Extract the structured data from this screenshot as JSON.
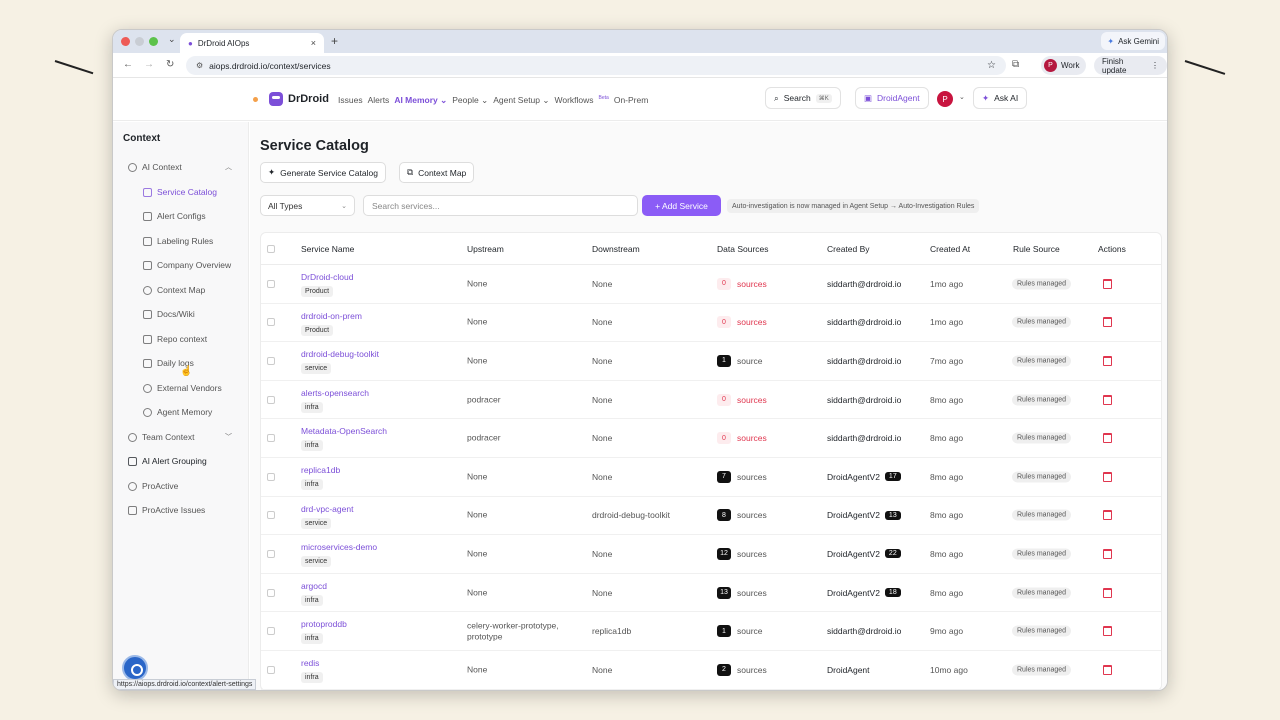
{
  "browser": {
    "tab_title": "DrDroid AIOps",
    "new_tab": "+",
    "ask_gemini": "Ask Gemini",
    "url": "aiops.drdroid.io/context/services",
    "profile_label": "Work",
    "profile_initial": "P",
    "finish_update": "Finish update",
    "status_url": "https://aiops.drdroid.io/context/alert-settings"
  },
  "header": {
    "brand": "DrDroid",
    "nav": [
      {
        "label": "Issues"
      },
      {
        "label": "Alerts"
      },
      {
        "label": "AI Memory ⌄"
      },
      {
        "label": "People ⌄"
      },
      {
        "label": "Agent Setup ⌄"
      },
      {
        "label": "Workflows"
      },
      {
        "label": "On-Prem"
      }
    ],
    "beta": "Beta",
    "search_label": "Search",
    "search_kbd": "⌘K",
    "droidagent_label": "DroidAgent",
    "avatar_initial": "P",
    "ask_ai_label": "Ask AI"
  },
  "sidebar": {
    "title": "Context",
    "items": [
      {
        "label": "AI Context"
      },
      {
        "label": "Service Catalog"
      },
      {
        "label": "Alert Configs"
      },
      {
        "label": "Labeling Rules"
      },
      {
        "label": "Company Overview"
      },
      {
        "label": "Context Map"
      },
      {
        "label": "Docs/Wiki"
      },
      {
        "label": "Repo context"
      },
      {
        "label": "Daily logs"
      },
      {
        "label": "External Vendors"
      },
      {
        "label": "Agent Memory"
      },
      {
        "label": "Team Context"
      },
      {
        "label": "AI Alert Grouping"
      },
      {
        "label": "ProActive"
      },
      {
        "label": "ProActive Issues"
      }
    ]
  },
  "main": {
    "title": "Service Catalog",
    "generate_label": "Generate Service Catalog",
    "context_map_label": "Context Map",
    "type_filter": "All Types",
    "search_placeholder": "Search services...",
    "add_service_label": "+ Add Service",
    "notice": "Auto-investigation is now managed in Agent Setup → Auto-Investigation Rules",
    "columns": [
      "Service Name",
      "Upstream",
      "Downstream",
      "Data Sources",
      "Created By",
      "Created At",
      "Rule Source",
      "Actions"
    ],
    "rows": [
      {
        "name": "DrDroid-cloud",
        "tag": "Product",
        "upstream": "None",
        "downstream": "None",
        "ds_count": "0",
        "ds_label": "sources",
        "created_by": "siddarth@drdroid.io",
        "created_count": "",
        "created_at": "1mo ago",
        "rule_source": "Rules managed"
      },
      {
        "name": "drdroid-on-prem",
        "tag": "Product",
        "upstream": "None",
        "downstream": "None",
        "ds_count": "0",
        "ds_label": "sources",
        "created_by": "siddarth@drdroid.io",
        "created_count": "",
        "created_at": "1mo ago",
        "rule_source": "Rules managed"
      },
      {
        "name": "drdroid-debug-toolkit",
        "tag": "service",
        "upstream": "None",
        "downstream": "None",
        "ds_count": "1",
        "ds_label": "source",
        "created_by": "siddarth@drdroid.io",
        "created_count": "",
        "created_at": "7mo ago",
        "rule_source": "Rules managed"
      },
      {
        "name": "alerts-opensearch",
        "tag": "infra",
        "upstream": "podracer",
        "downstream": "None",
        "ds_count": "0",
        "ds_label": "sources",
        "created_by": "siddarth@drdroid.io",
        "created_count": "",
        "created_at": "8mo ago",
        "rule_source": "Rules managed"
      },
      {
        "name": "Metadata-OpenSearch",
        "tag": "infra",
        "upstream": "podracer",
        "downstream": "None",
        "ds_count": "0",
        "ds_label": "sources",
        "created_by": "siddarth@drdroid.io",
        "created_count": "",
        "created_at": "8mo ago",
        "rule_source": "Rules managed"
      },
      {
        "name": "replica1db",
        "tag": "infra",
        "upstream": "None",
        "downstream": "None",
        "ds_count": "7",
        "ds_label": "sources",
        "created_by": "DroidAgentV2",
        "created_count": "17",
        "created_at": "8mo ago",
        "rule_source": "Rules managed"
      },
      {
        "name": "drd-vpc-agent",
        "tag": "service",
        "upstream": "None",
        "downstream": "drdroid-debug-toolkit",
        "ds_count": "8",
        "ds_label": "sources",
        "created_by": "DroidAgentV2",
        "created_count": "13",
        "created_at": "8mo ago",
        "rule_source": "Rules managed"
      },
      {
        "name": "microservices-demo",
        "tag": "service",
        "upstream": "None",
        "downstream": "None",
        "ds_count": "12",
        "ds_label": "sources",
        "created_by": "DroidAgentV2",
        "created_count": "22",
        "created_at": "8mo ago",
        "rule_source": "Rules managed"
      },
      {
        "name": "argocd",
        "tag": "infra",
        "upstream": "None",
        "downstream": "None",
        "ds_count": "13",
        "ds_label": "sources",
        "created_by": "DroidAgentV2",
        "created_count": "18",
        "created_at": "8mo ago",
        "rule_source": "Rules managed"
      },
      {
        "name": "protoproddb",
        "tag": "infra",
        "upstream": "celery-worker-prototype, prototype",
        "downstream": "replica1db",
        "ds_count": "1",
        "ds_label": "source",
        "created_by": "siddarth@drdroid.io",
        "created_count": "",
        "created_at": "9mo ago",
        "rule_source": "Rules managed"
      },
      {
        "name": "redis",
        "tag": "infra",
        "upstream": "None",
        "downstream": "None",
        "ds_count": "2",
        "ds_label": "sources",
        "created_by": "DroidAgent",
        "created_count": "",
        "created_at": "10mo ago",
        "rule_source": "Rules managed"
      }
    ]
  },
  "colors": {
    "accent": "#7c4fd8",
    "button": "#8b5cf6",
    "danger": "#e0364f",
    "background": "#f6f1e4"
  }
}
